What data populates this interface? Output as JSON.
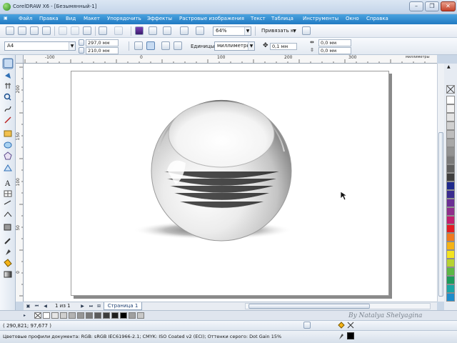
{
  "window": {
    "title": "CorelDRAW X6 - [Безымянный-1]",
    "buttons": [
      "–",
      "❐",
      "✕"
    ]
  },
  "menu": [
    "Файл",
    "Правка",
    "Вид",
    "Макет",
    "Упорядочить",
    "Эффекты",
    "Растровые изображения",
    "Текст",
    "Таблица",
    "Инструменты",
    "Окно",
    "Справка"
  ],
  "toolbar": {
    "zoom": "64%",
    "snap": "Привязать к"
  },
  "property_bar": {
    "paper_size": "A4",
    "width": "297,0 мм",
    "height": "210,0 мм",
    "units_label": "Единицы:",
    "units_value": "миллиметры",
    "nudge": "0,1 мм",
    "dup_x": "0,0 мм",
    "dup_y": "0,0 мм"
  },
  "rulers": {
    "h_ticks": [
      "-100",
      "0",
      "100",
      "200",
      "300"
    ],
    "h_unit": "миллиметры",
    "v_unit": "миллиметры",
    "v_ticks": [
      "200",
      "150",
      "100",
      "50",
      "0"
    ]
  },
  "page_nav": {
    "counter": "1 из 1",
    "tab": "Страница 1"
  },
  "status": {
    "coords": "( 290,821; 97,677 )",
    "profile": "Цветовые профили документа: RGB: sRGB IEC61966-2.1; CMYK: ISO Coated v2 (ECI); Оттенки серого: Dot Gain 15%"
  },
  "watermark": "By Natalya Shelyagina",
  "colors": {
    "menubar": "#2179c2",
    "palette": [
      "#ffffff",
      "#f2f2f2",
      "#e3e3e3",
      "#d0d0d0",
      "#bdbdbd",
      "#a8a8a8",
      "#929292",
      "#7a7a7a",
      "#5f5f5f",
      "#3f3f3f",
      "#1e2a8c",
      "#3a2c8f",
      "#6a2f94",
      "#8f2f8c",
      "#c21f6f",
      "#e31d26",
      "#ef7a22",
      "#f5b316",
      "#f3e321",
      "#b7d332",
      "#5db846",
      "#1c9b5c",
      "#1aa6a6",
      "#1e8dcc"
    ],
    "doc_swatches": [
      "#ffffff",
      "#e6e6e6",
      "#cfcfcf",
      "#b3b3b3",
      "#969696",
      "#7a7a7a",
      "#5c5c5c",
      "#3d3d3d",
      "#1f1f1f",
      "#000000",
      "#a0a0a0",
      "#c8c8c8"
    ]
  },
  "icons": [
    "pick-tool-icon",
    "shape-tool-icon",
    "crop-tool-icon",
    "zoom-tool-icon",
    "freehand-tool-icon",
    "smart-fill-icon",
    "rectangle-tool-icon",
    "ellipse-tool-icon",
    "polygon-tool-icon",
    "text-tool-icon",
    "table-tool-icon",
    "dimension-tool-icon",
    "connector-tool-icon",
    "interactive-tool-icon",
    "eyedropper-icon",
    "outline-pen-icon",
    "fill-tool-icon",
    "interactive-fill-icon"
  ]
}
